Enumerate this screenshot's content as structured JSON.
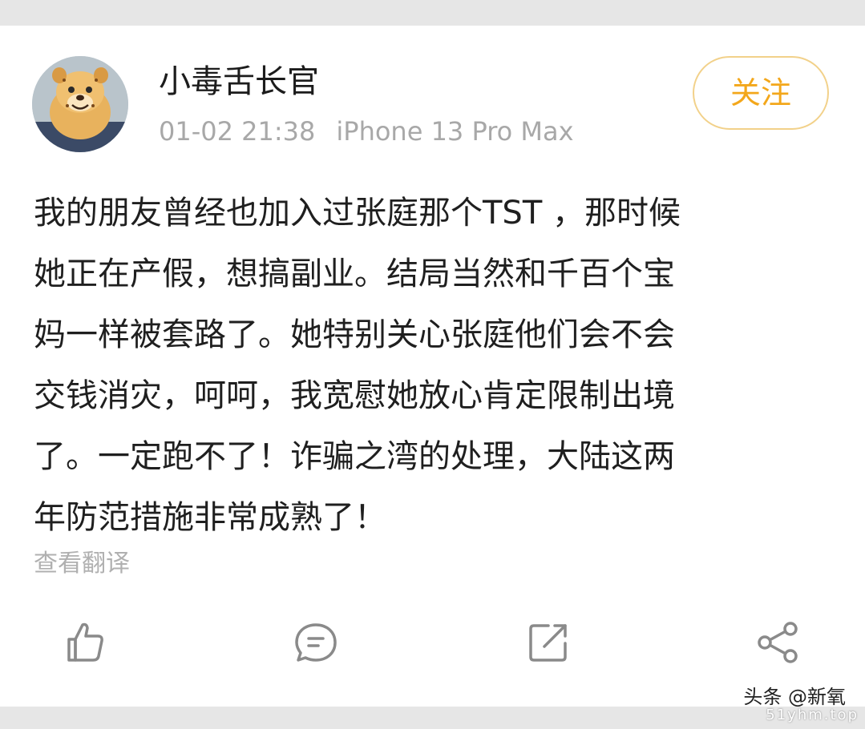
{
  "post": {
    "username": "小毒舌长官",
    "timestamp": "01-02 21:38",
    "device": "iPhone 13 Pro Max",
    "follow_label": "关注",
    "text_lines": [
      "我的朋友曾经也加入过张庭那个TST ，那时候",
      "她正在产假，想搞副业。结局当然和千百个宝",
      "妈一样被套路了。她特别关心张庭他们会不会",
      "交钱消灾，呵呵，我宽慰她放心肯定限制出境",
      "了。一定跑不了！诈骗之湾的处理，大陆这两",
      "年防范措施非常成熟了！"
    ],
    "translate_label": "查看翻译"
  },
  "actions": {
    "like_icon": "thumbs-up-icon",
    "comment_icon": "comment-icon",
    "repost_icon": "repost-icon",
    "share_icon": "share-icon"
  },
  "watermark": {
    "text": "头条 @新氧",
    "subtext": "51yhm.top"
  },
  "colors": {
    "accent": "#f3a71b",
    "follow_border": "#f2d18a",
    "muted_text": "#a8a8a8",
    "icon": "#8a8a8a"
  }
}
